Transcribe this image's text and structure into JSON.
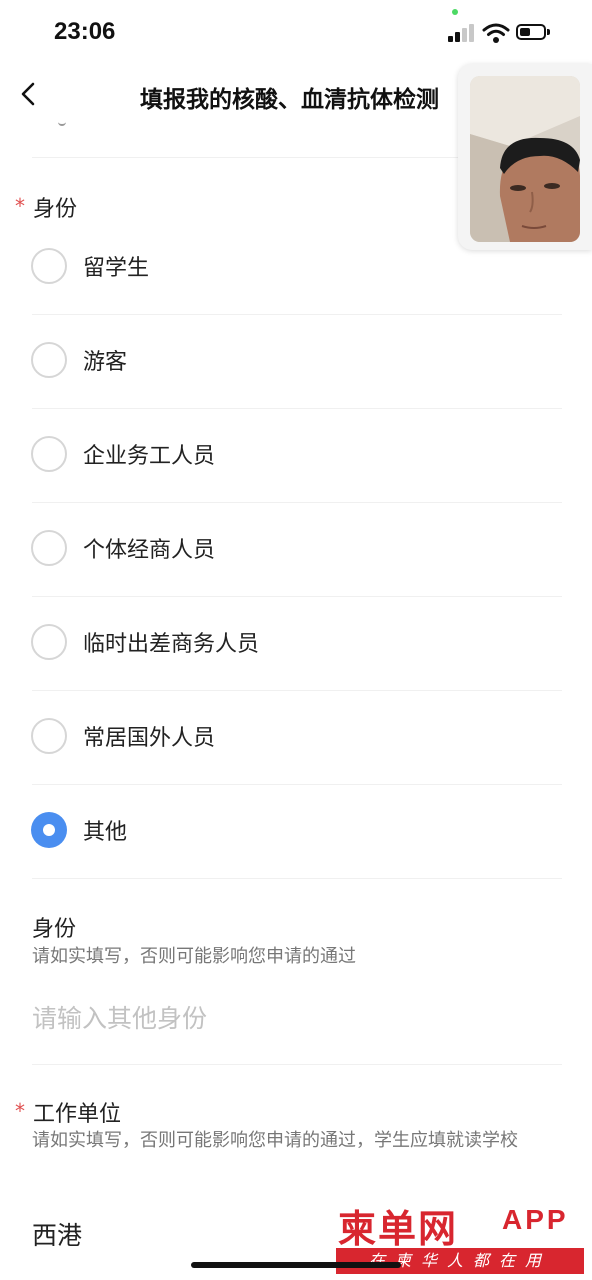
{
  "status_bar": {
    "time": "23:06"
  },
  "nav": {
    "title": "填报我的核酸、血清抗体检测"
  },
  "identity_section": {
    "required_star": "*",
    "label": "身份",
    "options": [
      {
        "label": "留学生",
        "selected": false
      },
      {
        "label": "游客",
        "selected": false
      },
      {
        "label": "企业务工人员",
        "selected": false
      },
      {
        "label": "个体经商人员",
        "selected": false
      },
      {
        "label": "临时出差商务人员",
        "selected": false
      },
      {
        "label": "常居国外人员",
        "selected": false
      },
      {
        "label": "其他",
        "selected": true
      }
    ]
  },
  "other_identity": {
    "label": "身份",
    "description": "请如实填写，否则可能影响您申请的通过",
    "placeholder": "请输入其他身份",
    "value": ""
  },
  "work_unit": {
    "required_star": "*",
    "label": "工作单位",
    "description": "请如实填写，否则可能影响您申请的通过，学生应填就读学校",
    "value": "西港"
  },
  "watermark": {
    "logo": "柬单网",
    "app": "APP",
    "slogan": "在柬华人都在用"
  },
  "colors": {
    "accent": "#4a8ef0",
    "required": "#e05050",
    "watermark_red": "#d8262f"
  }
}
